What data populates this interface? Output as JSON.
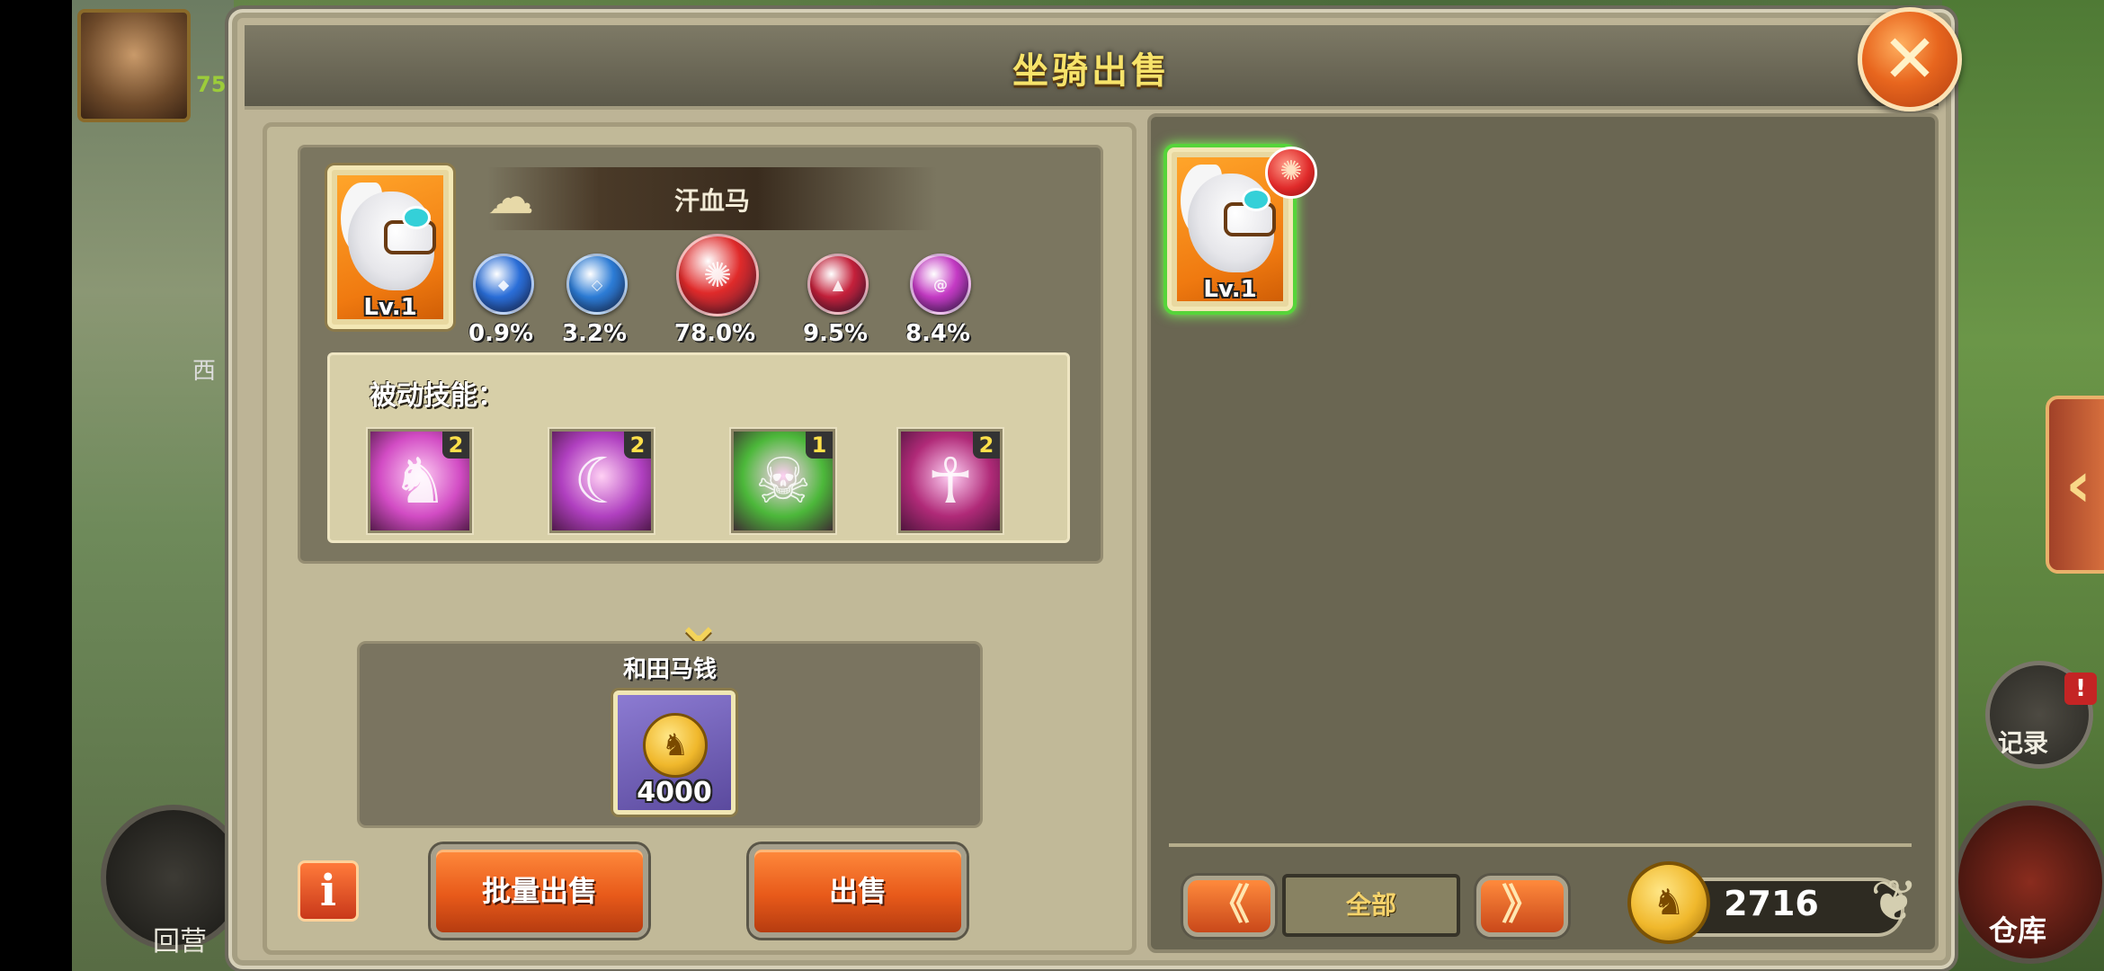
{
  "dialog": {
    "title": "坐骑出售",
    "close_icon": "close-icon"
  },
  "hud": {
    "player_level": "75",
    "world_sign": "西",
    "left_button_label": "回营",
    "record_label": "记录",
    "record_badge": "!",
    "warehouse_label": "仓库",
    "side_tab_arrow": "‹"
  },
  "mount": {
    "name": "汗血马",
    "level": "Lv.1",
    "stats": [
      {
        "icon": "water-orb-icon",
        "value": "0.9%",
        "color": "#2a6ed8"
      },
      {
        "icon": "wind-orb-icon",
        "value": "3.2%",
        "color": "#2c7cd6"
      },
      {
        "icon": "fire-orb-icon",
        "value": "78.0%",
        "color": "#e02a2a"
      },
      {
        "icon": "flame-orb-icon",
        "value": "9.5%",
        "color": "#c4203a"
      },
      {
        "icon": "arcane-orb-icon",
        "value": "8.4%",
        "color": "#c43ac4"
      }
    ]
  },
  "skills": {
    "title": "被动技能：",
    "items": [
      {
        "icon": "rider-skill-icon",
        "level": "2",
        "color": "#d24cc4"
      },
      {
        "icon": "claw-skill-icon",
        "level": "2",
        "color": "#b040c0"
      },
      {
        "icon": "poison-skull-skill-icon",
        "level": "1",
        "color": "#4cb83a"
      },
      {
        "icon": "meditation-skill-icon",
        "level": "2",
        "color": "#b02a78"
      }
    ]
  },
  "reward": {
    "name": "和田马钱",
    "amount": "4000",
    "icon": "horse-coin-icon"
  },
  "buttons": {
    "info": "i",
    "batch_sell": "批量出售",
    "sell": "出售"
  },
  "inventory": {
    "slot_1_level": "Lv.1",
    "slot_1_badge_icon": "fire-element-badge-icon",
    "filter_label": "全部",
    "prev_arrow": "《",
    "next_arrow": "》",
    "gold_amount": "2716"
  }
}
